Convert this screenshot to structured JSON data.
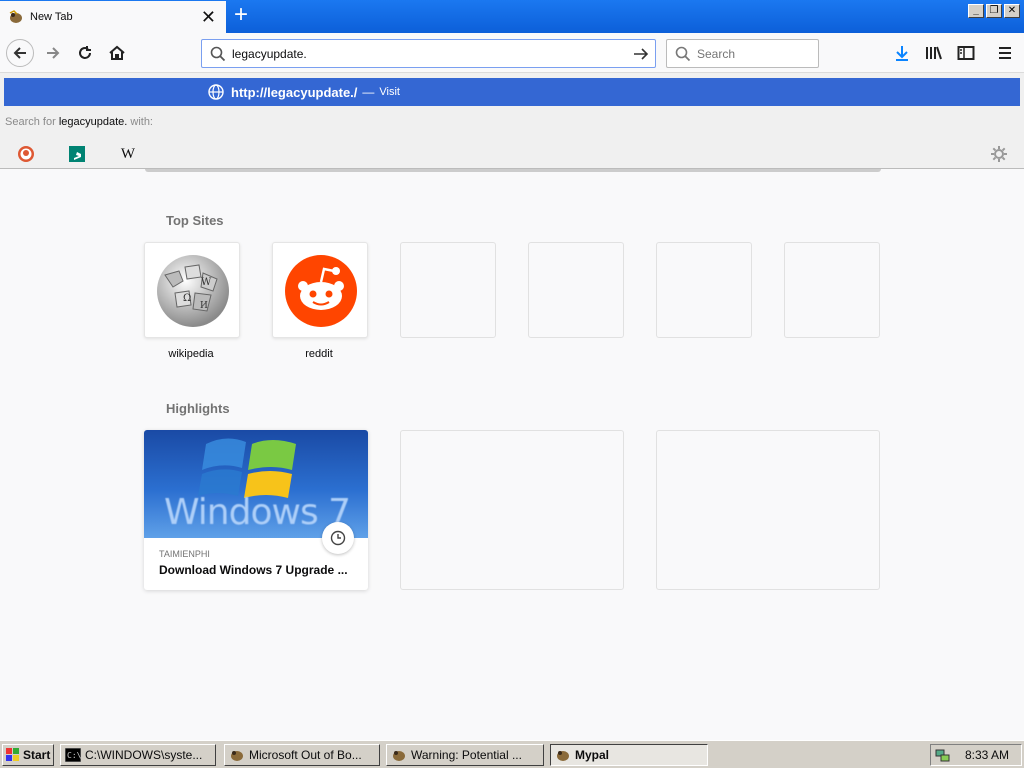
{
  "browser": {
    "tab_title": "New Tab",
    "url_value": "legacyupdate.",
    "search_placeholder": "Search"
  },
  "urlbar_popup": {
    "visit_url": "http://legacyupdate./",
    "visit_separator": "—",
    "visit_action": "Visit",
    "search_for_prefix": "Search for",
    "search_query": "legacyupdate.",
    "search_for_suffix": "with:",
    "engines": [
      "duckduckgo-icon",
      "bing-icon",
      "wikipedia-icon"
    ]
  },
  "newtab": {
    "top_sites_title": "Top Sites",
    "top_sites": [
      {
        "label": "wikipedia",
        "icon": "wikipedia-globe-icon"
      },
      {
        "label": "reddit",
        "icon": "reddit-icon"
      }
    ],
    "highlights_title": "Highlights",
    "highlights": [
      {
        "source": "TAIMIENPHI",
        "title": "Download Windows 7 Upgrade ...",
        "thumb_text": "Windows 7"
      }
    ]
  },
  "taskbar": {
    "start_label": "Start",
    "tasks": [
      {
        "label": "C:\\WINDOWS\\syste..."
      },
      {
        "label": "Microsoft Out of Bo..."
      },
      {
        "label": "Warning: Potential ..."
      },
      {
        "label": "Mypal"
      }
    ],
    "clock": "8:33 AM"
  },
  "colors": {
    "titlebar": "#0c5fd9",
    "visit_row": "#3467d3",
    "reddit": "#ff4500"
  }
}
